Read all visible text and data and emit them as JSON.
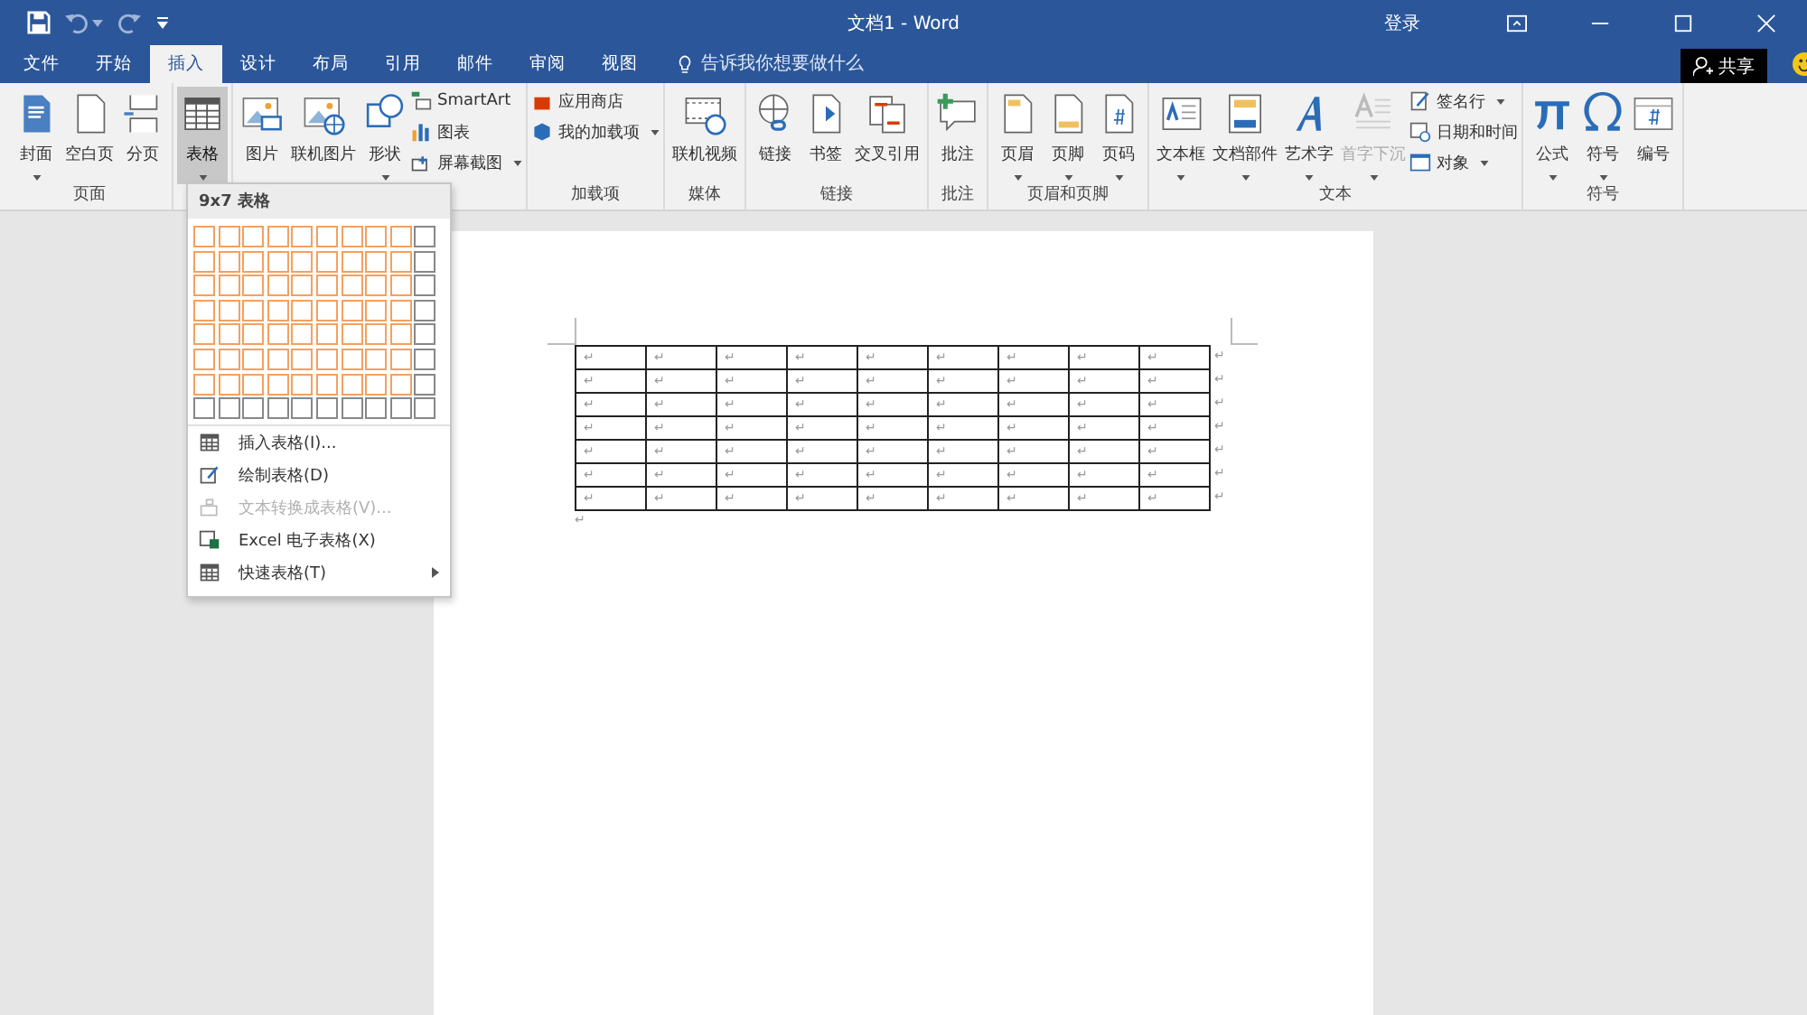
{
  "window": {
    "title": "文档1 - Word",
    "sign_in": "登录",
    "share": "共享"
  },
  "tabs": [
    {
      "label": "文件",
      "selected": false
    },
    {
      "label": "开始",
      "selected": false
    },
    {
      "label": "插入",
      "selected": true
    },
    {
      "label": "设计",
      "selected": false
    },
    {
      "label": "布局",
      "selected": false
    },
    {
      "label": "引用",
      "selected": false
    },
    {
      "label": "邮件",
      "selected": false
    },
    {
      "label": "审阅",
      "selected": false
    },
    {
      "label": "视图",
      "selected": false
    }
  ],
  "tell_me": {
    "placeholder": "告诉我你想要做什么"
  },
  "ribbon_groups": [
    {
      "label": "页面",
      "buttons": [
        {
          "kind": "large",
          "label": "封面",
          "dropdown": true,
          "selected": false,
          "disabled": false
        },
        {
          "kind": "large",
          "label": "空白页",
          "dropdown": false,
          "selected": false,
          "disabled": false
        },
        {
          "kind": "large",
          "label": "分页",
          "dropdown": false,
          "selected": false,
          "disabled": false
        }
      ]
    },
    {
      "buttons": [
        {
          "kind": "large",
          "label": "表格",
          "dropdown": true,
          "selected": true,
          "disabled": false
        }
      ]
    },
    {
      "buttons": [
        {
          "kind": "large",
          "label": "图片",
          "dropdown": false,
          "selected": false,
          "disabled": false
        },
        {
          "kind": "large",
          "label": "联机图片",
          "dropdown": false,
          "selected": false,
          "disabled": false
        },
        {
          "kind": "large",
          "label": "形状",
          "dropdown": true,
          "selected": false,
          "disabled": false
        },
        {
          "kind": "small",
          "label": "SmartArt",
          "dropdown": false,
          "selected": false,
          "disabled": false
        },
        {
          "kind": "small",
          "label": "图表",
          "dropdown": false,
          "selected": false,
          "disabled": false
        },
        {
          "kind": "small",
          "label": "屏幕截图",
          "dropdown": true,
          "selected": false,
          "disabled": false
        }
      ]
    },
    {
      "label": "加载项",
      "buttons": [
        {
          "kind": "small",
          "label": "应用商店",
          "dropdown": false,
          "selected": false,
          "disabled": false
        },
        {
          "kind": "small",
          "label": "我的加载项",
          "dropdown": true,
          "selected": false,
          "disabled": false
        }
      ]
    },
    {
      "label": "媒体",
      "buttons": [
        {
          "kind": "large",
          "label": "联机视频",
          "dropdown": false,
          "selected": false,
          "disabled": false
        }
      ]
    },
    {
      "label": "链接",
      "buttons": [
        {
          "kind": "large",
          "label": "链接",
          "dropdown": false,
          "selected": false,
          "disabled": false
        },
        {
          "kind": "large",
          "label": "书签",
          "dropdown": false,
          "selected": false,
          "disabled": false
        },
        {
          "kind": "large",
          "label": "交叉引用",
          "dropdown": false,
          "selected": false,
          "disabled": false
        }
      ]
    },
    {
      "label": "批注",
      "buttons": [
        {
          "kind": "large",
          "label": "批注",
          "dropdown": false,
          "selected": false,
          "disabled": false
        }
      ]
    },
    {
      "label": "页眉和页脚",
      "buttons": [
        {
          "kind": "large",
          "label": "页眉",
          "dropdown": true,
          "selected": false,
          "disabled": false
        },
        {
          "kind": "large",
          "label": "页脚",
          "dropdown": true,
          "selected": false,
          "disabled": false
        },
        {
          "kind": "large",
          "label": "页码",
          "dropdown": true,
          "selected": false,
          "disabled": false
        }
      ]
    },
    {
      "label": "文本",
      "buttons": [
        {
          "kind": "large",
          "label": "文本框",
          "dropdown": true,
          "selected": false,
          "disabled": false
        },
        {
          "kind": "large",
          "label": "文档部件",
          "dropdown": true,
          "selected": false,
          "disabled": false
        },
        {
          "kind": "large",
          "label": "艺术字",
          "dropdown": true,
          "selected": false,
          "disabled": false
        },
        {
          "kind": "large",
          "label": "首字下沉",
          "dropdown": true,
          "selected": false,
          "disabled": true
        },
        {
          "kind": "small",
          "label": "签名行",
          "dropdown": true,
          "selected": false,
          "disabled": false
        },
        {
          "kind": "small",
          "label": "日期和时间",
          "dropdown": false,
          "selected": false,
          "disabled": false
        },
        {
          "kind": "small",
          "label": "对象",
          "dropdown": true,
          "selected": false,
          "disabled": false
        }
      ]
    },
    {
      "label": "符号",
      "buttons": [
        {
          "kind": "large",
          "label": "公式",
          "dropdown": true,
          "selected": false,
          "disabled": false
        },
        {
          "kind": "large",
          "label": "符号",
          "dropdown": true,
          "selected": false,
          "disabled": false
        },
        {
          "kind": "large",
          "label": "编号",
          "dropdown": false,
          "selected": false,
          "disabled": false
        }
      ]
    }
  ],
  "table_menu": {
    "header": "9x7 表格",
    "grid_rows": [
      {
        "cells": [
          {
            "selected": true
          },
          {
            "selected": true
          },
          {
            "selected": true
          },
          {
            "selected": true
          },
          {
            "selected": true
          },
          {
            "selected": true
          },
          {
            "selected": true
          },
          {
            "selected": true
          },
          {
            "selected": true
          },
          {
            "selected": false
          }
        ]
      },
      {
        "cells": [
          {
            "selected": true
          },
          {
            "selected": true
          },
          {
            "selected": true
          },
          {
            "selected": true
          },
          {
            "selected": true
          },
          {
            "selected": true
          },
          {
            "selected": true
          },
          {
            "selected": true
          },
          {
            "selected": true
          },
          {
            "selected": false
          }
        ]
      },
      {
        "cells": [
          {
            "selected": true
          },
          {
            "selected": true
          },
          {
            "selected": true
          },
          {
            "selected": true
          },
          {
            "selected": true
          },
          {
            "selected": true
          },
          {
            "selected": true
          },
          {
            "selected": true
          },
          {
            "selected": true
          },
          {
            "selected": false
          }
        ]
      },
      {
        "cells": [
          {
            "selected": true
          },
          {
            "selected": true
          },
          {
            "selected": true
          },
          {
            "selected": true
          },
          {
            "selected": true
          },
          {
            "selected": true
          },
          {
            "selected": true
          },
          {
            "selected": true
          },
          {
            "selected": true
          },
          {
            "selected": false
          }
        ]
      },
      {
        "cells": [
          {
            "selected": true
          },
          {
            "selected": true
          },
          {
            "selected": true
          },
          {
            "selected": true
          },
          {
            "selected": true
          },
          {
            "selected": true
          },
          {
            "selected": true
          },
          {
            "selected": true
          },
          {
            "selected": true
          },
          {
            "selected": false
          }
        ]
      },
      {
        "cells": [
          {
            "selected": true
          },
          {
            "selected": true
          },
          {
            "selected": true
          },
          {
            "selected": true
          },
          {
            "selected": true
          },
          {
            "selected": true
          },
          {
            "selected": true
          },
          {
            "selected": true
          },
          {
            "selected": true
          },
          {
            "selected": false
          }
        ]
      },
      {
        "cells": [
          {
            "selected": true
          },
          {
            "selected": true
          },
          {
            "selected": true
          },
          {
            "selected": true
          },
          {
            "selected": true
          },
          {
            "selected": true
          },
          {
            "selected": true
          },
          {
            "selected": true
          },
          {
            "selected": true
          },
          {
            "selected": false
          }
        ]
      },
      {
        "cells": [
          {
            "selected": false
          },
          {
            "selected": false
          },
          {
            "selected": false
          },
          {
            "selected": false
          },
          {
            "selected": false
          },
          {
            "selected": false
          },
          {
            "selected": false
          },
          {
            "selected": false
          },
          {
            "selected": false
          },
          {
            "selected": false
          }
        ]
      }
    ],
    "items": [
      {
        "label": "插入表格(I)...",
        "disabled": false,
        "submenu": false
      },
      {
        "label": "绘制表格(D)",
        "disabled": false,
        "submenu": false
      },
      {
        "label": "文本转换成表格(V)...",
        "disabled": true,
        "submenu": false
      },
      {
        "label": "Excel 电子表格(X)",
        "disabled": false,
        "submenu": false
      },
      {
        "label": "快速表格(T)",
        "disabled": false,
        "submenu": true
      }
    ]
  },
  "document": {
    "table_rows": [
      [
        "↵",
        "↵",
        "↵",
        "↵",
        "↵",
        "↵",
        "↵",
        "↵",
        "↵"
      ],
      [
        "↵",
        "↵",
        "↵",
        "↵",
        "↵",
        "↵",
        "↵",
        "↵",
        "↵"
      ],
      [
        "↵",
        "↵",
        "↵",
        "↵",
        "↵",
        "↵",
        "↵",
        "↵",
        "↵"
      ],
      [
        "↵",
        "↵",
        "↵",
        "↵",
        "↵",
        "↵",
        "↵",
        "↵",
        "↵"
      ],
      [
        "↵",
        "↵",
        "↵",
        "↵",
        "↵",
        "↵",
        "↵",
        "↵",
        "↵"
      ],
      [
        "↵",
        "↵",
        "↵",
        "↵",
        "↵",
        "↵",
        "↵",
        "↵",
        "↵"
      ],
      [
        "↵",
        "↵",
        "↵",
        "↵",
        "↵",
        "↵",
        "↵",
        "↵",
        "↵"
      ]
    ],
    "row_end_marks": [
      "↵",
      "↵",
      "↵",
      "↵",
      "↵",
      "↵",
      "↵"
    ],
    "paragraph_mark": "↵"
  }
}
